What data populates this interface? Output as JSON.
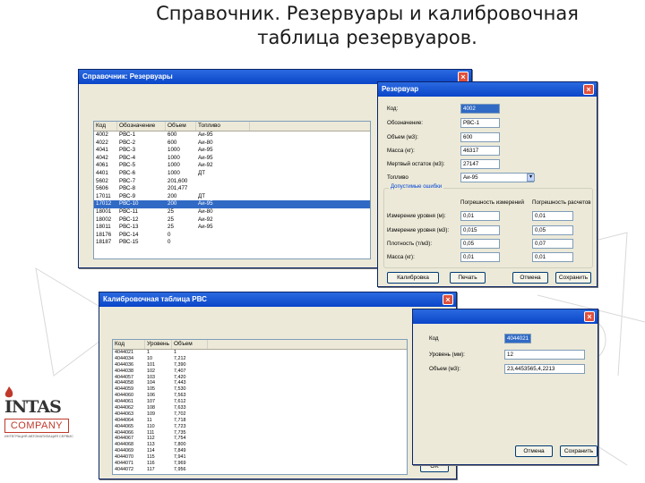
{
  "slide": {
    "title_line1": "Справочник. Резервуары и калибровочная",
    "title_line2": "таблица резервуаров."
  },
  "logo": {
    "brand": "INTAS",
    "sub": "COMPANY",
    "tagline": "ИНТЕГРАЦИЯ АВТОМАТИЗАЦИЯ СЕРВИС"
  },
  "ref_window": {
    "title": "Справочник: Резервуары",
    "columns": [
      "Код",
      "Обозначение",
      "Объем",
      "Топливо"
    ],
    "rows": [
      [
        "4002",
        "РВС-1",
        "600",
        "Аи-95"
      ],
      [
        "4022",
        "РВС-2",
        "600",
        "Аи-80"
      ],
      [
        "4041",
        "РВС-3",
        "1000",
        "Аи-95"
      ],
      [
        "4042",
        "РВС-4",
        "1000",
        "Аи-95"
      ],
      [
        "4061",
        "РВС-5",
        "1000",
        "Аи-92"
      ],
      [
        "4401",
        "РВС-6",
        "1000",
        "ДТ"
      ],
      [
        "5602",
        "РВС-7",
        "201,600",
        ""
      ],
      [
        "5606",
        "РВС-8",
        "201,477",
        ""
      ],
      [
        "17011",
        "РВС-9",
        "200",
        "ДТ"
      ],
      [
        "17012",
        "РВС-10",
        "200",
        "Аи-95"
      ],
      [
        "18001",
        "РВС-11",
        "25",
        "Аи-80"
      ],
      [
        "18002",
        "РВС-12",
        "25",
        "Аи-92"
      ],
      [
        "18011",
        "РВС-13",
        "25",
        "Аи-95"
      ],
      [
        "18176",
        "РВС-14",
        "0",
        ""
      ],
      [
        "18187",
        "РВС-15",
        "0",
        ""
      ]
    ],
    "selected_row": 9
  },
  "tank_window": {
    "title": "Резервуар",
    "fields": [
      {
        "label": "Код:",
        "value": "4002"
      },
      {
        "label": "Обозначение:",
        "value": "РВС-1"
      },
      {
        "label": "Объем (м3):",
        "value": "600"
      },
      {
        "label": "Масса (кг):",
        "value": "46317"
      },
      {
        "label": "Мертвый остаток (м3):",
        "value": "27147"
      },
      {
        "label": "Топливо",
        "value": "Аи-95"
      }
    ],
    "group_title": "Допустимые ошибки",
    "col1": "Погрешность измерений",
    "col2": "Погрешность расчетов",
    "error_rows": [
      {
        "label": "Измерение уровня (м):",
        "v1": "0,01",
        "v2": "0,01"
      },
      {
        "label": "Измерение уровня (м3):",
        "v1": "0,015",
        "v2": "0,05"
      },
      {
        "label": "Плотность (т/м3):",
        "v1": "0,05",
        "v2": "0,07"
      },
      {
        "label": "Масса (кг):",
        "v1": "0,01",
        "v2": "0,01"
      }
    ],
    "buttons": [
      "Калибровка",
      "Печать",
      "Отмена",
      "Сохранить"
    ]
  },
  "calib_window": {
    "title": "Калибровочная таблица РВС",
    "columns": [
      "Код",
      "Уровень",
      "Объем"
    ],
    "rows": [
      [
        "4044021",
        "1",
        "1"
      ],
      [
        "4044034",
        "10",
        "7,212"
      ],
      [
        "4044036",
        "101",
        "7,390"
      ],
      [
        "4044038",
        "102",
        "7,407"
      ],
      [
        "4044057",
        "103",
        "7,420"
      ],
      [
        "4044058",
        "104",
        "7,443"
      ],
      [
        "4044059",
        "105",
        "7,530"
      ],
      [
        "4044060",
        "106",
        "7,563"
      ],
      [
        "4044061",
        "107",
        "7,612"
      ],
      [
        "4044062",
        "108",
        "7,633"
      ],
      [
        "4044063",
        "109",
        "7,702"
      ],
      [
        "4044064",
        "11",
        "7,718"
      ],
      [
        "4044065",
        "110",
        "7,723"
      ],
      [
        "4044066",
        "111",
        "7,735"
      ],
      [
        "4044067",
        "112",
        "7,754"
      ],
      [
        "4044068",
        "113",
        "7,800"
      ],
      [
        "4044069",
        "114",
        "7,849"
      ],
      [
        "4044070",
        "115",
        "7,941"
      ],
      [
        "4044071",
        "116",
        "7,969"
      ],
      [
        "4044072",
        "117",
        "7,956"
      ]
    ],
    "ok_label": "OK"
  },
  "edit_window": {
    "fields": [
      {
        "label": "Код",
        "value": "4044021"
      },
      {
        "label": "Уровень (мм):",
        "value": "12"
      },
      {
        "label": "Объем (м3):",
        "value": "23,4453565,4,2213"
      }
    ],
    "buttons": [
      "Отмена",
      "Сохранить"
    ]
  }
}
